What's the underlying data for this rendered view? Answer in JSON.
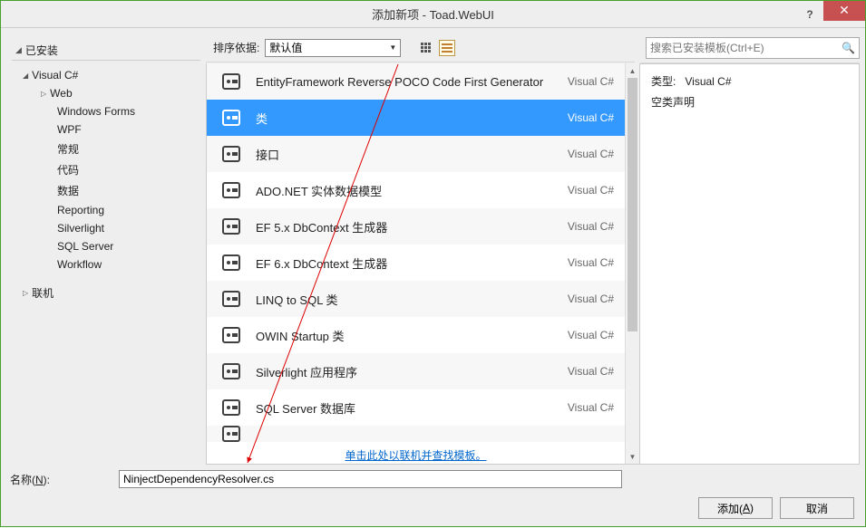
{
  "window": {
    "title": "添加新项 - Toad.WebUI"
  },
  "tree": {
    "header": "已安装",
    "root": "Visual C#",
    "web": "Web",
    "items": [
      "Windows Forms",
      "WPF",
      "常规",
      "代码",
      "数据",
      "Reporting",
      "Silverlight",
      "SQL Server",
      "Workflow"
    ],
    "online": "联机"
  },
  "toolbar": {
    "sort_label": "排序依据:",
    "sort_value": "默认值"
  },
  "search": {
    "placeholder": "搜索已安装模板(Ctrl+E)"
  },
  "items": [
    {
      "name": "EntityFramework Reverse POCO Code First Generator",
      "type": "Visual C#"
    },
    {
      "name": "类",
      "type": "Visual C#",
      "selected": true
    },
    {
      "name": "接口",
      "type": "Visual C#"
    },
    {
      "name": "ADO.NET 实体数据模型",
      "type": "Visual C#"
    },
    {
      "name": "EF 5.x DbContext 生成器",
      "type": "Visual C#"
    },
    {
      "name": "EF 6.x DbContext 生成器",
      "type": "Visual C#"
    },
    {
      "name": "LINQ to SQL 类",
      "type": "Visual C#"
    },
    {
      "name": "OWIN Startup 类",
      "type": "Visual C#"
    },
    {
      "name": "Silverlight 应用程序",
      "type": "Visual C#"
    },
    {
      "name": "SQL Server 数据库",
      "type": "Visual C#"
    }
  ],
  "link": "单击此处以联机并查找模板。",
  "details": {
    "type_label": "类型:",
    "type_value": "Visual C#",
    "desc": "空类声明"
  },
  "name_field": {
    "label_prefix": "名称(",
    "label_key": "N",
    "label_suffix": "):",
    "value": "NinjectDependencyResolver.cs"
  },
  "buttons": {
    "add_prefix": "添加(",
    "add_key": "A",
    "add_suffix": ")",
    "cancel": "取消"
  },
  "chart_data": null
}
